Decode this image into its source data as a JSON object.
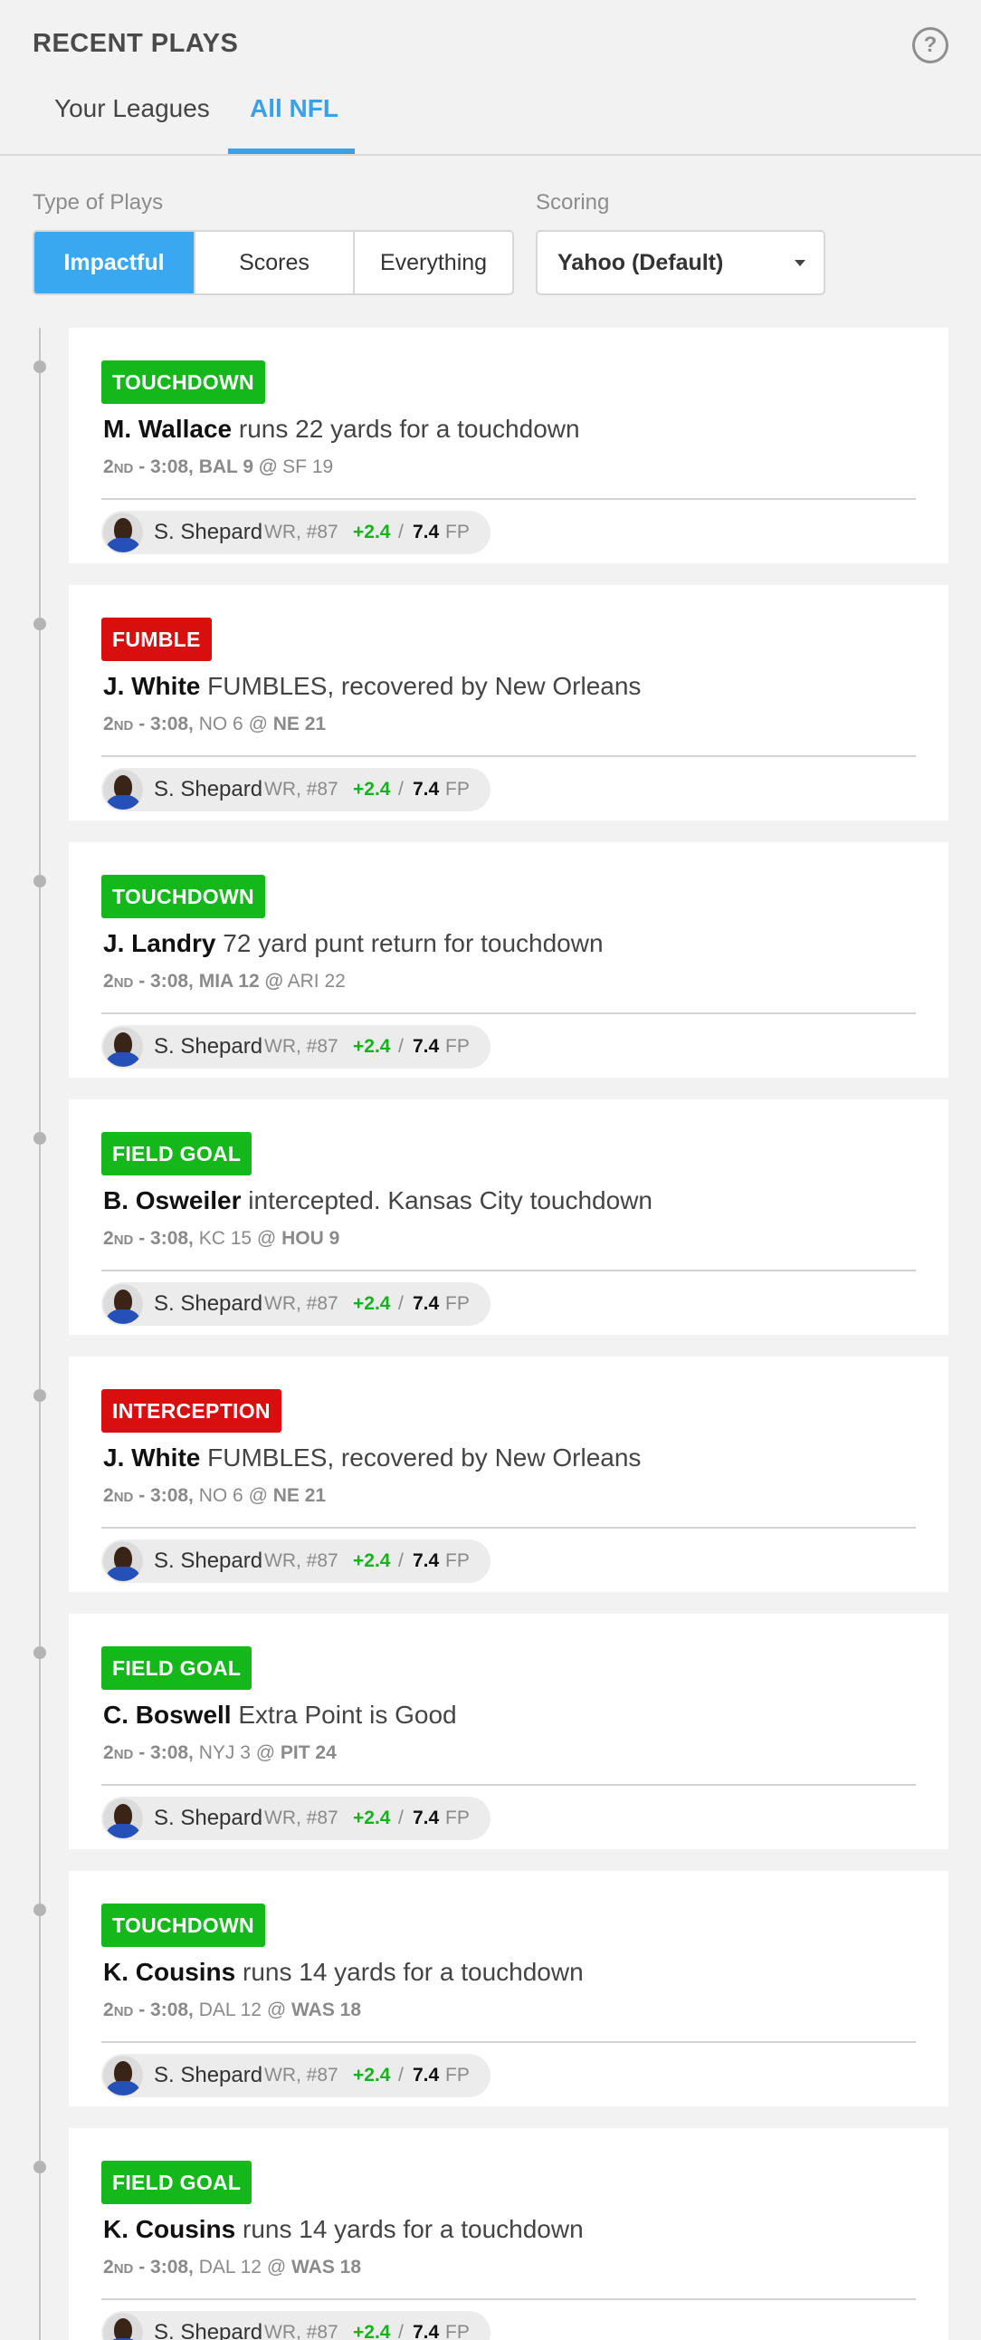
{
  "header": {
    "title": "RECENT PLAYS",
    "help_icon": "question-circle-icon"
  },
  "tabs": [
    {
      "label": "Your Leagues",
      "active": false
    },
    {
      "label": "All NFL",
      "active": true
    }
  ],
  "filters": {
    "type_label": "Type of Plays",
    "type_options": [
      {
        "label": "Impactful",
        "active": true
      },
      {
        "label": "Scores",
        "active": false
      },
      {
        "label": "Everything",
        "active": false
      }
    ],
    "scoring_label": "Scoring",
    "scoring_value": "Yahoo (Default)"
  },
  "colors": {
    "accent": "#3aa0e8",
    "positive": "#14b81b",
    "negative": "#d90f0f"
  },
  "player": {
    "name": "S. Shepard",
    "pos": "WR, #87",
    "delta": "+2.4",
    "slash": "/",
    "total": "7.4",
    "unit": "FP"
  },
  "plays": [
    {
      "tag": "TOUCHDOWN",
      "color": "green",
      "player": "M. Wallace",
      "desc": " runs 22 yards for a touchdown",
      "q1": "2",
      "q2": "ND",
      "clock": " - 3:08,",
      "away": " BAL 9",
      "at": " @",
      "home": " SF 19",
      "bold_side": "away"
    },
    {
      "tag": "FUMBLE",
      "color": "red",
      "player": "J. White",
      "desc": " FUMBLES, recovered by New Orleans",
      "q1": "2",
      "q2": "ND",
      "clock": " - 3:08,",
      "away": " NO 6",
      "at": " @",
      "home": " NE 21",
      "bold_side": "home"
    },
    {
      "tag": "TOUCHDOWN",
      "color": "green",
      "player": "J. Landry",
      "desc": " 72 yard punt return for touchdown",
      "q1": "2",
      "q2": "ND",
      "clock": " - 3:08,",
      "away": " MIA 12",
      "at": " @",
      "home": " ARI 22",
      "bold_side": "away"
    },
    {
      "tag": "FIELD GOAL",
      "color": "green",
      "player": "B. Osweiler",
      "desc": " intercepted. Kansas City touchdown",
      "q1": "2",
      "q2": "ND",
      "clock": " - 3:08,",
      "away": " KC 15",
      "at": " @",
      "home": " HOU 9",
      "bold_side": "home"
    },
    {
      "tag": "INTERCEPTION",
      "color": "red",
      "player": "J. White",
      "desc": " FUMBLES, recovered by New Orleans",
      "q1": "2",
      "q2": "ND",
      "clock": " - 3:08,",
      "away": " NO 6",
      "at": " @",
      "home": " NE 21",
      "bold_side": "home"
    },
    {
      "tag": "FIELD GOAL",
      "color": "green",
      "player": "C. Boswell",
      "desc": " Extra Point is Good",
      "q1": "2",
      "q2": "ND",
      "clock": " - 3:08,",
      "away": " NYJ 3",
      "at": " @",
      "home": " PIT 24",
      "bold_side": "home"
    },
    {
      "tag": "TOUCHDOWN",
      "color": "green",
      "player": "K. Cousins",
      "desc": " runs 14 yards for a touchdown",
      "q1": "2",
      "q2": "ND",
      "clock": " - 3:08,",
      "away": " DAL 12",
      "at": " @",
      "home": " WAS 18",
      "bold_side": "home"
    },
    {
      "tag": "FIELD GOAL",
      "color": "green",
      "player": "K. Cousins",
      "desc": " runs 14 yards for a touchdown",
      "q1": "2",
      "q2": "ND",
      "clock": " - 3:08,",
      "away": " DAL 12",
      "at": " @",
      "home": " WAS 18",
      "bold_side": "home"
    }
  ]
}
